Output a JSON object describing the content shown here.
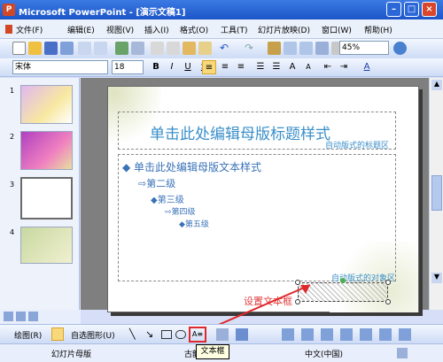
{
  "window": {
    "title": "Microsoft PowerPoint - [演示文稿1]"
  },
  "menu": [
    "文件(F)",
    "编辑(E)",
    "视图(V)",
    "插入(I)",
    "格式(O)",
    "工具(T)",
    "幻灯片放映(D)",
    "窗口(W)",
    "帮助(H)"
  ],
  "toolbar": {
    "zoom": "45%"
  },
  "format": {
    "font": "宋体",
    "size": "18",
    "bold": "B",
    "italic": "I",
    "underline": "U",
    "shadow": "S",
    "font_color": "A"
  },
  "thumbnails": [
    "1",
    "2",
    "3",
    "4"
  ],
  "slide": {
    "title": "单击此处编辑母版标题样式",
    "title_area_label": "自动版式的标题区",
    "levels": [
      "单击此处编辑母版文本样式",
      "第二级",
      "第三级",
      "第四级",
      "第五级"
    ],
    "object_area_label": "自动版式的对象区"
  },
  "annotation": {
    "text": "设置文本框"
  },
  "draw": {
    "draw_label": "绘图(R)",
    "autoshapes_label": "自选图形(U)"
  },
  "status": {
    "left": "幻灯片母版",
    "mid": "古韵",
    "lang": "中文(中国)"
  },
  "tooltip": "文本框",
  "colors": {
    "accent": "#3a8fc9",
    "highlight": "#e0282b"
  }
}
